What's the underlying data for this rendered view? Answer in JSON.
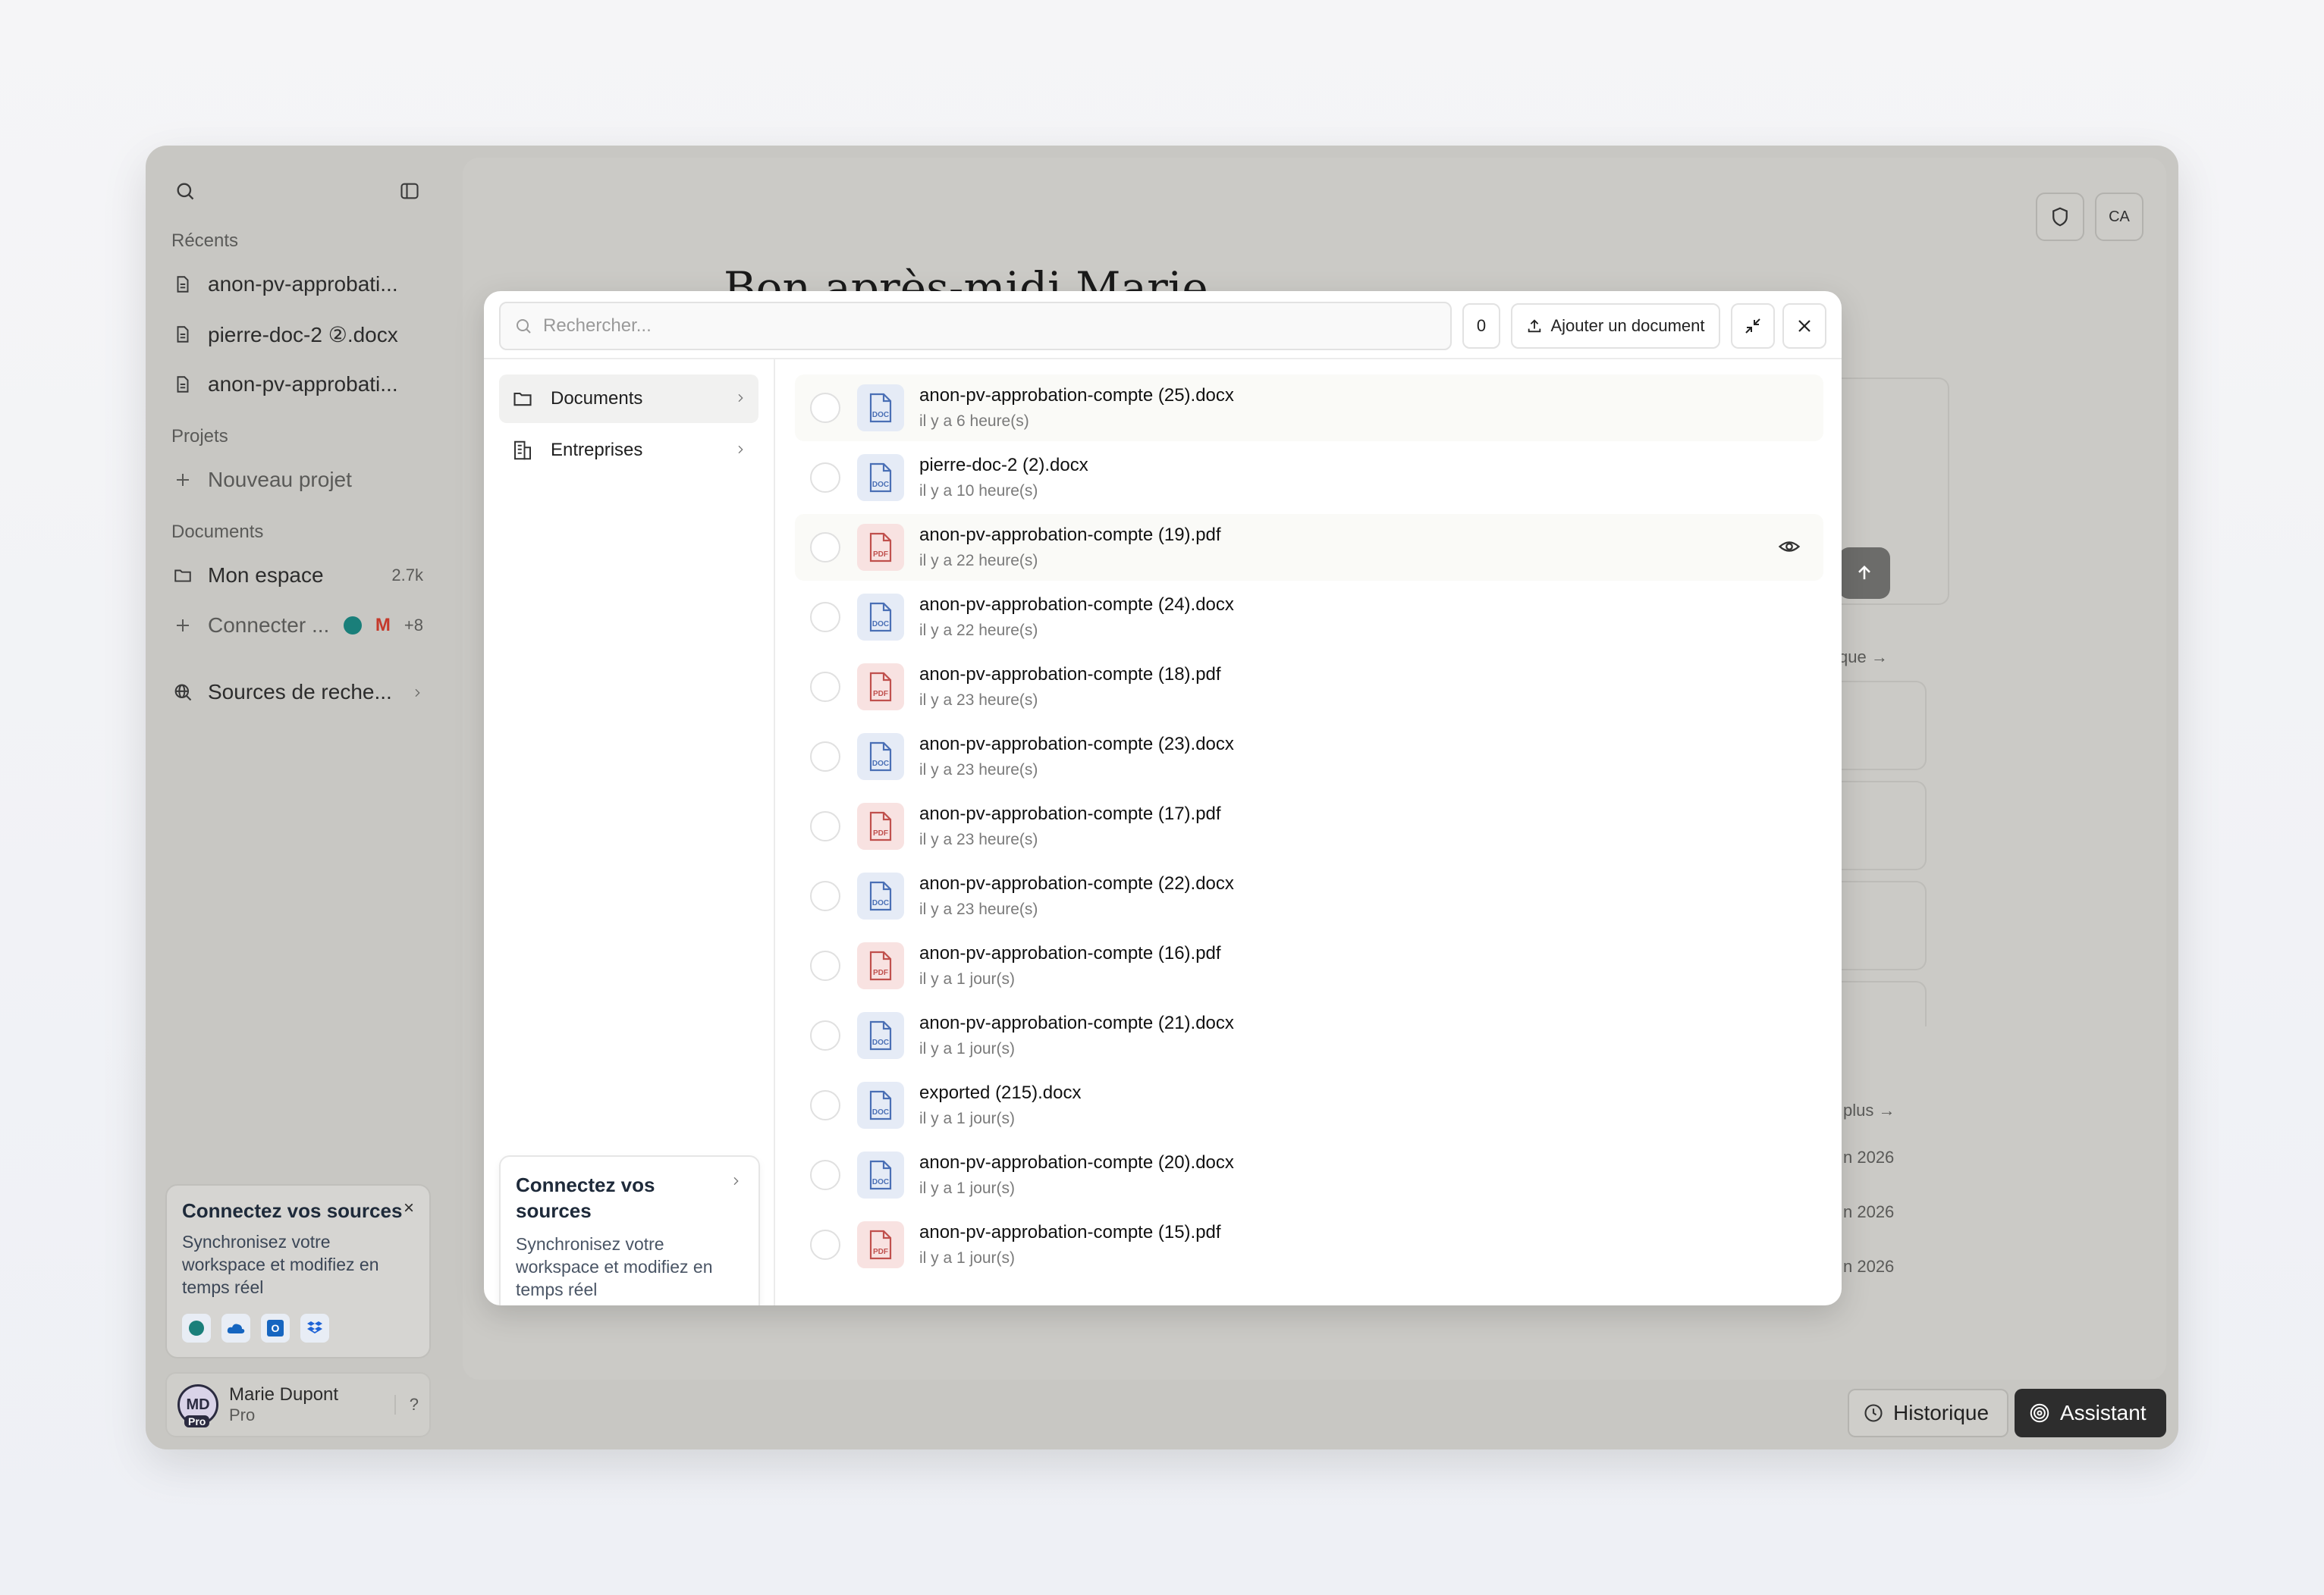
{
  "sidebar": {
    "recents_label": "Récents",
    "recents": [
      {
        "label": "anon-pv-approbati..."
      },
      {
        "label": "pierre-doc-2 ②.docx"
      },
      {
        "label": "anon-pv-approbati..."
      }
    ],
    "projects_label": "Projets",
    "new_project": "Nouveau projet",
    "documents_label": "Documents",
    "my_space": "Mon espace",
    "my_space_count": "2.7k",
    "connect": "Connecter ...",
    "connect_more": "+8",
    "research_sources": "Sources de reche...",
    "promo": {
      "title": "Connectez vos sources",
      "text": "Synchronisez votre workspace et modifiez en temps réel",
      "close": "×"
    },
    "user": {
      "initials": "MD",
      "badge": "Pro",
      "name": "Marie Dupont",
      "plan": "Pro",
      "help": "?"
    }
  },
  "main": {
    "greeting": "Bon après-midi Marie",
    "avatar_initials": "CA",
    "frag_link1": "que →",
    "frag_link2": "plus →",
    "frag_dates": [
      "n 2026",
      "n 2026",
      "n 2026"
    ],
    "historique": "Historique",
    "assistant": "Assistant"
  },
  "modal": {
    "search_placeholder": "Rechercher...",
    "selected_count": "0",
    "add_document": "Ajouter un document",
    "nav": [
      {
        "label": "Documents"
      },
      {
        "label": "Entreprises"
      }
    ],
    "connect_card": {
      "title": "Connectez vos sources",
      "text": "Synchronisez votre workspace et modifiez en temps réel"
    },
    "files": [
      {
        "name": "anon-pv-approbation-compte (25).docx",
        "date": "il y a 6 heure(s)",
        "type": "DOC"
      },
      {
        "name": "pierre-doc-2 (2).docx",
        "date": "il y a 10 heure(s)",
        "type": "DOC"
      },
      {
        "name": "anon-pv-approbation-compte (19).pdf",
        "date": "il y a 22 heure(s)",
        "type": "PDF"
      },
      {
        "name": "anon-pv-approbation-compte (24).docx",
        "date": "il y a 22 heure(s)",
        "type": "DOC"
      },
      {
        "name": "anon-pv-approbation-compte (18).pdf",
        "date": "il y a 23 heure(s)",
        "type": "PDF"
      },
      {
        "name": "anon-pv-approbation-compte (23).docx",
        "date": "il y a 23 heure(s)",
        "type": "DOC"
      },
      {
        "name": "anon-pv-approbation-compte (17).pdf",
        "date": "il y a 23 heure(s)",
        "type": "PDF"
      },
      {
        "name": "anon-pv-approbation-compte (22).docx",
        "date": "il y a 23 heure(s)",
        "type": "DOC"
      },
      {
        "name": "anon-pv-approbation-compte (16).pdf",
        "date": "il y a 1 jour(s)",
        "type": "PDF"
      },
      {
        "name": "anon-pv-approbation-compte (21).docx",
        "date": "il y a 1 jour(s)",
        "type": "DOC"
      },
      {
        "name": "exported (215).docx",
        "date": "il y a 1 jour(s)",
        "type": "DOC"
      },
      {
        "name": "anon-pv-approbation-compte (20).docx",
        "date": "il y a 1 jour(s)",
        "type": "DOC"
      },
      {
        "name": "anon-pv-approbation-compte (15).pdf",
        "date": "il y a 1 jour(s)",
        "type": "PDF"
      }
    ]
  },
  "colors": {
    "doc_icon": "#4a6fb5",
    "pdf_icon": "#c0504d",
    "assistant_bg": "#2d2d2d"
  }
}
